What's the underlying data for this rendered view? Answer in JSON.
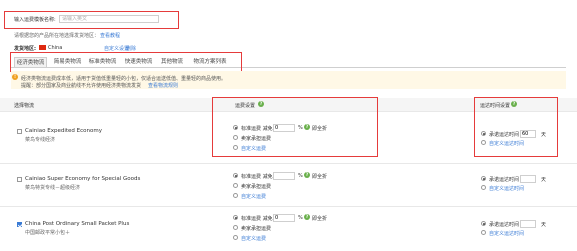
{
  "template": {
    "name_label": "输入运费模板名称:",
    "name_placeholder": "请输入英文",
    "tip_text": "请根据您的产品所在地选择发货地区：",
    "tip_link": "查看教程",
    "origin_label": "发货地区:",
    "origin_value": "China",
    "origin_actions": [
      "自定义设置",
      "删除"
    ]
  },
  "tabs": [
    {
      "label": "经济类物流",
      "active": true
    },
    {
      "label": "简易类物流",
      "active": false
    },
    {
      "label": "标准类物流",
      "active": false
    },
    {
      "label": "快速类物流",
      "active": false
    },
    {
      "label": "其他物流",
      "active": false
    },
    {
      "label": "物流方案列表",
      "active": false
    }
  ],
  "notice": {
    "line1": "经济类物流运费成本低，适用于货值低重量轻的小包，仅适合运送低值、重量轻的商品使用。",
    "line2_prefix": "提醒：部分国家及商业航线不允许使用经济类物流发货",
    "line2_link": "查看物流规则"
  },
  "columns": {
    "logistics": "选择物流",
    "freight": "运费设置",
    "delivery": "运达时间设置"
  },
  "carriers": [
    {
      "name": "Cainiao Expedited Economy",
      "sub": "菜鸟专线经济",
      "checked": false,
      "std_label": "标准运费 减免",
      "discount": "0",
      "pct": "%",
      "all_label": "即全折",
      "seller_label": "卖家承担运费",
      "custom_label": "自定义运费",
      "del_std_label": "承诺运达时间",
      "del_days": "60",
      "del_unit": "天",
      "del_custom_label": "自定义运达时间",
      "freight_sel": "std",
      "delivery_sel": "std"
    },
    {
      "name": "Cainiao Super Economy for Special Goods",
      "sub": "菜鸟特货专线－超级经济",
      "checked": false,
      "std_label": "标准运费 减免",
      "discount": "",
      "pct": "%",
      "all_label": "即全折",
      "seller_label": "卖家承担运费",
      "custom_label": "自定义运费",
      "del_std_label": "承诺运达时间",
      "del_days": "",
      "del_unit": "天",
      "del_custom_label": "自定义运达时间",
      "freight_sel": "std",
      "delivery_sel": "std"
    },
    {
      "name": "China Post Ordinary Small Packet Plus",
      "sub": "中国邮政平常小包＋",
      "checked": true,
      "std_label": "标准运费 减免",
      "discount": "0",
      "pct": "%",
      "all_label": "即全折",
      "seller_label": "卖家承担运费",
      "custom_label": "自定义运费",
      "del_std_label": "承诺运达时间",
      "del_days": "",
      "del_unit": "天",
      "del_custom_label": "自定义运达时间",
      "freight_sel": "std",
      "delivery_sel": "std"
    }
  ],
  "colors": {
    "highlight": "#e53b3b",
    "link": "#3a7bd5",
    "notice_bg": "#fff8e6",
    "help": "#6ab04c"
  }
}
